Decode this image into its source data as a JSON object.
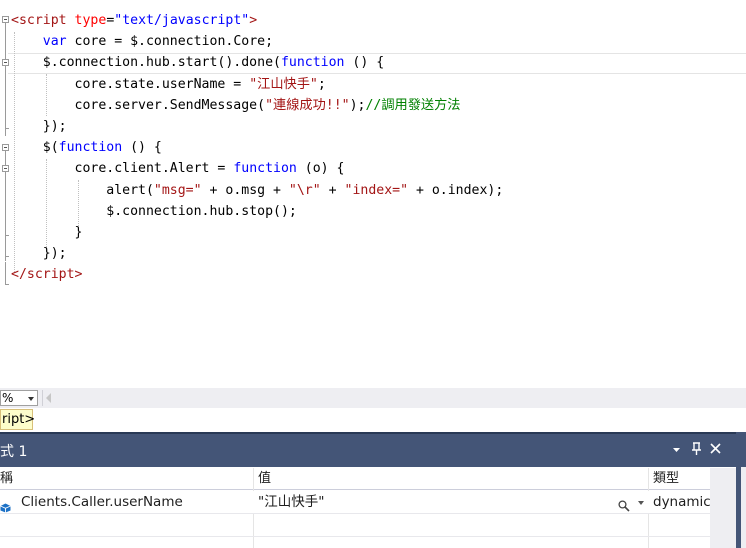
{
  "editor": {
    "lines": [
      {
        "parts": [
          [
            "t",
            "<"
          ],
          [
            "t",
            "script"
          ],
          [
            "x",
            " "
          ],
          [
            "a",
            "type"
          ],
          [
            "x",
            "="
          ],
          [
            "k",
            "\"text/javascript\""
          ],
          [
            "t",
            ">"
          ]
        ]
      },
      {
        "parts": [
          [
            "x",
            "    "
          ],
          [
            "k",
            "var"
          ],
          [
            "x",
            " core = $.connection.Core;"
          ]
        ]
      },
      {
        "parts": [
          [
            "x",
            "    $.connection.hub.start().done("
          ],
          [
            "k",
            "function"
          ],
          [
            "x",
            " () {"
          ]
        ]
      },
      {
        "parts": [
          [
            "x",
            "        core.state.userName = "
          ],
          [
            "s",
            "\"江山快手\""
          ],
          [
            "x",
            ";"
          ]
        ]
      },
      {
        "parts": [
          [
            "x",
            "        core.server.SendMessage("
          ],
          [
            "s",
            "\"連線成功!!\""
          ],
          [
            "x",
            ");"
          ],
          [
            "c",
            "//調用發送方法"
          ]
        ]
      },
      {
        "parts": [
          [
            "x",
            "    });"
          ]
        ]
      },
      {
        "parts": [
          [
            "x",
            "    $("
          ],
          [
            "k",
            "function"
          ],
          [
            "x",
            " () {"
          ]
        ]
      },
      {
        "parts": [
          [
            "x",
            "        core.client.Alert = "
          ],
          [
            "k",
            "function"
          ],
          [
            "x",
            " (o) {"
          ]
        ]
      },
      {
        "parts": [
          [
            "x",
            "            alert("
          ],
          [
            "s",
            "\"msg=\""
          ],
          [
            "x",
            " + o.msg + "
          ],
          [
            "s",
            "\"\\r\""
          ],
          [
            "x",
            " + "
          ],
          [
            "s",
            "\"index=\""
          ],
          [
            "x",
            " + o.index);"
          ]
        ]
      },
      {
        "parts": [
          [
            "x",
            "            $.connection.hub.stop();"
          ]
        ]
      },
      {
        "parts": [
          [
            "x",
            "        }"
          ]
        ]
      },
      {
        "parts": [
          [
            "x",
            "    });"
          ]
        ]
      },
      {
        "parts": [
          [
            "t",
            "</"
          ],
          [
            "t",
            "script"
          ],
          [
            "t",
            ">"
          ]
        ]
      }
    ]
  },
  "status": {
    "zoom": "%",
    "breadcrumb": "ript>"
  },
  "watch": {
    "title": "式 1",
    "pin_icon": "↕",
    "columns": {
      "name": "稱",
      "value": "值",
      "type": "類型"
    },
    "rows": [
      {
        "name": "Clients.Caller.userName",
        "value": "\"江山快手\"",
        "type": "dynamic"
      }
    ]
  },
  "colors": {
    "keyword": "#0000ff",
    "tag": "#a31515",
    "attribute": "#ff0000",
    "string": "#a31515",
    "comment": "#008000",
    "panel_title": "#445577"
  }
}
